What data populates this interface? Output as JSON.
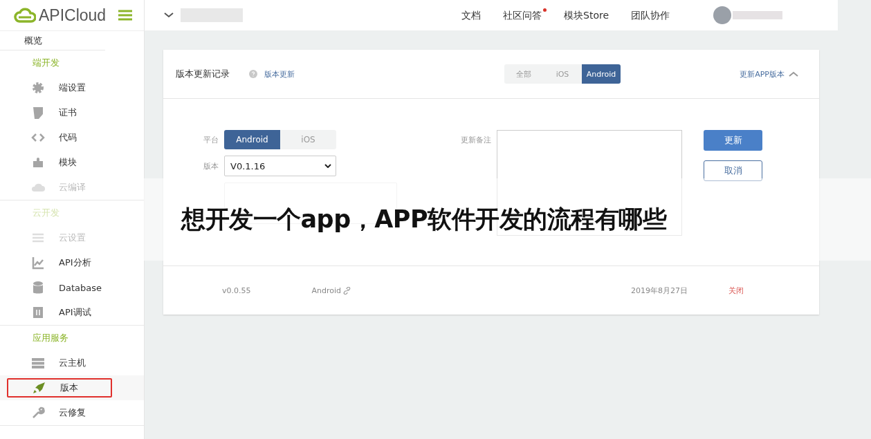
{
  "brand": {
    "name": "APICloud"
  },
  "top_nav": [
    {
      "label": "文档",
      "notification": false
    },
    {
      "label": "社区问答",
      "notification": true
    },
    {
      "label": "模块Store",
      "notification": false
    },
    {
      "label": "团队协作",
      "notification": false
    }
  ],
  "sidebar": {
    "overview": {
      "label": "概览",
      "selected": false
    },
    "sections": [
      {
        "heading": "端开发",
        "disabled": false,
        "items": [
          {
            "label": "端设置",
            "disabled": false,
            "selected": false
          },
          {
            "label": "证书",
            "disabled": false,
            "selected": false
          },
          {
            "label": "代码",
            "disabled": false,
            "selected": false
          },
          {
            "label": "模块",
            "disabled": false,
            "selected": false
          },
          {
            "label": "云编译",
            "disabled": true,
            "selected": false
          }
        ]
      },
      {
        "heading": "云开发",
        "disabled": true,
        "items": [
          {
            "label": "云设置",
            "disabled": true,
            "selected": false
          },
          {
            "label": "API分析",
            "disabled": false,
            "selected": false
          },
          {
            "label": "Database",
            "disabled": false,
            "selected": false
          },
          {
            "label": "API调试",
            "disabled": false,
            "selected": false
          }
        ]
      },
      {
        "heading": "应用服务",
        "disabled": false,
        "items": [
          {
            "label": "云主机",
            "disabled": false,
            "selected": false
          },
          {
            "label": "版本",
            "disabled": false,
            "selected": true
          },
          {
            "label": "云修复",
            "disabled": false,
            "selected": false
          }
        ]
      }
    ]
  },
  "card": {
    "title": "版本更新记录",
    "help_link": "版本更新",
    "filter_tabs": [
      {
        "label": "全部",
        "selected": false
      },
      {
        "label": "iOS",
        "selected": false
      },
      {
        "label": "Android",
        "selected": true
      }
    ],
    "update_link": {
      "label": "更新APP版本",
      "expanded": true
    },
    "form": {
      "platform_label": "平台",
      "platforms": [
        {
          "label": "Android",
          "selected": true
        },
        {
          "label": "iOS",
          "selected": false
        }
      ],
      "version_label": "版本",
      "version_value": "V0.1.16",
      "notes_label": "更新备注",
      "buttons": [
        {
          "label": "更新",
          "kind": "primary"
        },
        {
          "label": "取消",
          "kind": "secondary"
        }
      ]
    },
    "records": [
      {
        "version": "v0.0.55",
        "platform": "Android",
        "date": "2019年8月27日",
        "action": "关闭"
      }
    ]
  },
  "overlay_title": "想开发一个app，APP软件开发的流程有哪些"
}
